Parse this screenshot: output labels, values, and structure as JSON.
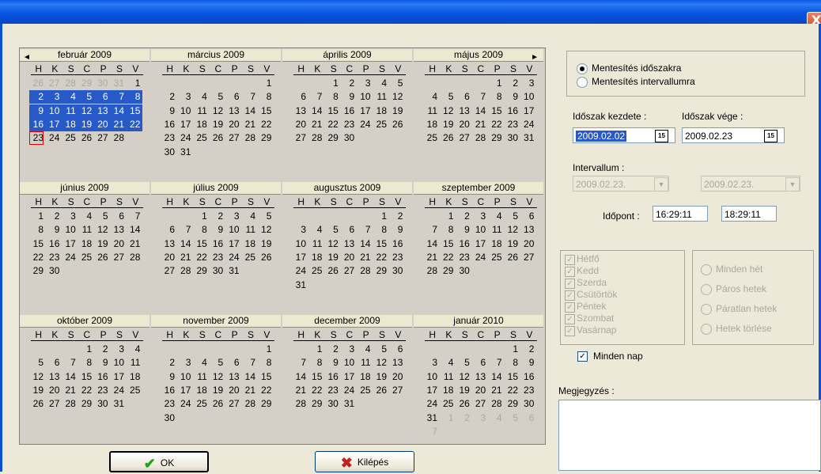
{
  "window": {
    "close_glyph": "X"
  },
  "calendar": {
    "prev_arrow": "◄",
    "next_arrow": "►",
    "dow": [
      "H",
      "K",
      "S",
      "C",
      "P",
      "S",
      "V"
    ],
    "months": [
      {
        "title": "február 2009",
        "start": 6,
        "days": 28,
        "prevtail": [
          26,
          27,
          28,
          29,
          30,
          31
        ],
        "next": 0,
        "selected": [
          2,
          22
        ],
        "today": 23
      },
      {
        "title": "március 2009",
        "start": 6,
        "days": 31,
        "prevtail": [],
        "next": 0
      },
      {
        "title": "április 2009",
        "start": 2,
        "days": 30,
        "prevtail": [],
        "next": 0
      },
      {
        "title": "május 2009",
        "start": 4,
        "days": 31,
        "prevtail": [],
        "next": 0
      },
      {
        "title": "június 2009",
        "start": 0,
        "days": 30,
        "prevtail": [],
        "next": 0
      },
      {
        "title": "július 2009",
        "start": 2,
        "days": 31,
        "prevtail": [],
        "next": 0
      },
      {
        "title": "augusztus 2009",
        "start": 5,
        "days": 31,
        "prevtail": [],
        "next": 0
      },
      {
        "title": "szeptember 2009",
        "start": 1,
        "days": 30,
        "prevtail": [],
        "next": 0
      },
      {
        "title": "október 2009",
        "start": 3,
        "days": 31,
        "prevtail": [],
        "next": 0
      },
      {
        "title": "november 2009",
        "start": 6,
        "days": 30,
        "prevtail": [],
        "next": 0
      },
      {
        "title": "december 2009",
        "start": 1,
        "days": 31,
        "prevtail": [],
        "next": 0
      },
      {
        "title": "január 2010",
        "start": 5,
        "days": 31,
        "prevtail": [],
        "next": 7
      }
    ]
  },
  "mode": {
    "option1": "Mentesítés időszakra",
    "option2": "Mentesítés intervallumra",
    "selected": 1
  },
  "period": {
    "start_label": "Időszak kezdete :",
    "start_value": "2009.02.02",
    "end_label": "Időszak vége :",
    "end_value": "2009.02.23",
    "cal_glyph": "15"
  },
  "interval": {
    "label": "Intervallum :",
    "from": "2009.02.23.",
    "to": "2009.02.23.",
    "dd_glyph": "▼"
  },
  "time": {
    "label": "Időpont :",
    "from": "16:29:11",
    "to": "18:29:11"
  },
  "days": [
    "Hétfő",
    "Kedd",
    "Szerda",
    "Csütörtök",
    "Péntek",
    "Szombat",
    "Vasárnap"
  ],
  "check_glyph": "✓",
  "weeks": [
    "Minden hét",
    "Páros hetek",
    "Páratlan hetek",
    "Hetek törlése"
  ],
  "every_day": {
    "label": "Minden nap",
    "checked": true
  },
  "note": {
    "label": "Megjegyzés :"
  },
  "buttons": {
    "ok": "OK",
    "ok_icon": "✔",
    "ok_color": "#1F9F1F",
    "exit": "Kilépés",
    "exit_icon": "✖",
    "exit_color": "#C81E1E"
  }
}
